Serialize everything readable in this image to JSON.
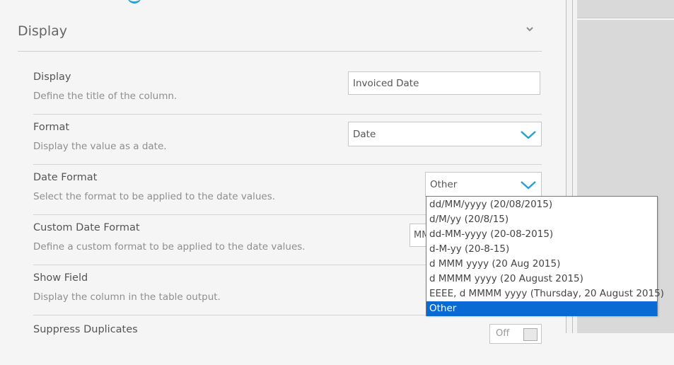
{
  "section": {
    "title": "Display"
  },
  "rows": [
    {
      "label": "Display",
      "description": "Define the title of the column.",
      "value": "Invoiced Date"
    },
    {
      "label": "Format",
      "description": "Display the value as a date.",
      "value": "Date"
    },
    {
      "label": "Date Format",
      "description": "Select the format to be applied to the date values.",
      "value": "Other"
    },
    {
      "label": "Custom Date Format",
      "description": "Define a custom format to be applied to the date values.",
      "value": "MM"
    },
    {
      "label": "Show Field",
      "description": "Display the column in the table output."
    },
    {
      "label": "Suppress Duplicates",
      "toggle_value": "Off"
    }
  ],
  "date_format_options": [
    "dd/MM/yyyy (20/08/2015)",
    "d/M/yy (20/8/15)",
    "dd-MM-yyyy (20-08-2015)",
    "d-M-yy (20-8-15)",
    "d MMM yyyy (20 Aug 2015)",
    "d MMMM yyyy (20 August 2015)",
    "EEEE, d MMMM yyyy (Thursday, 20 August 2015)",
    "Other"
  ],
  "selected_option": "Other",
  "colors": {
    "accent": "#2a9fd6",
    "selection": "#0a6ad4"
  },
  "icons": {
    "collapse": "chevron-down-icon",
    "select": "chevron-down-icon"
  }
}
